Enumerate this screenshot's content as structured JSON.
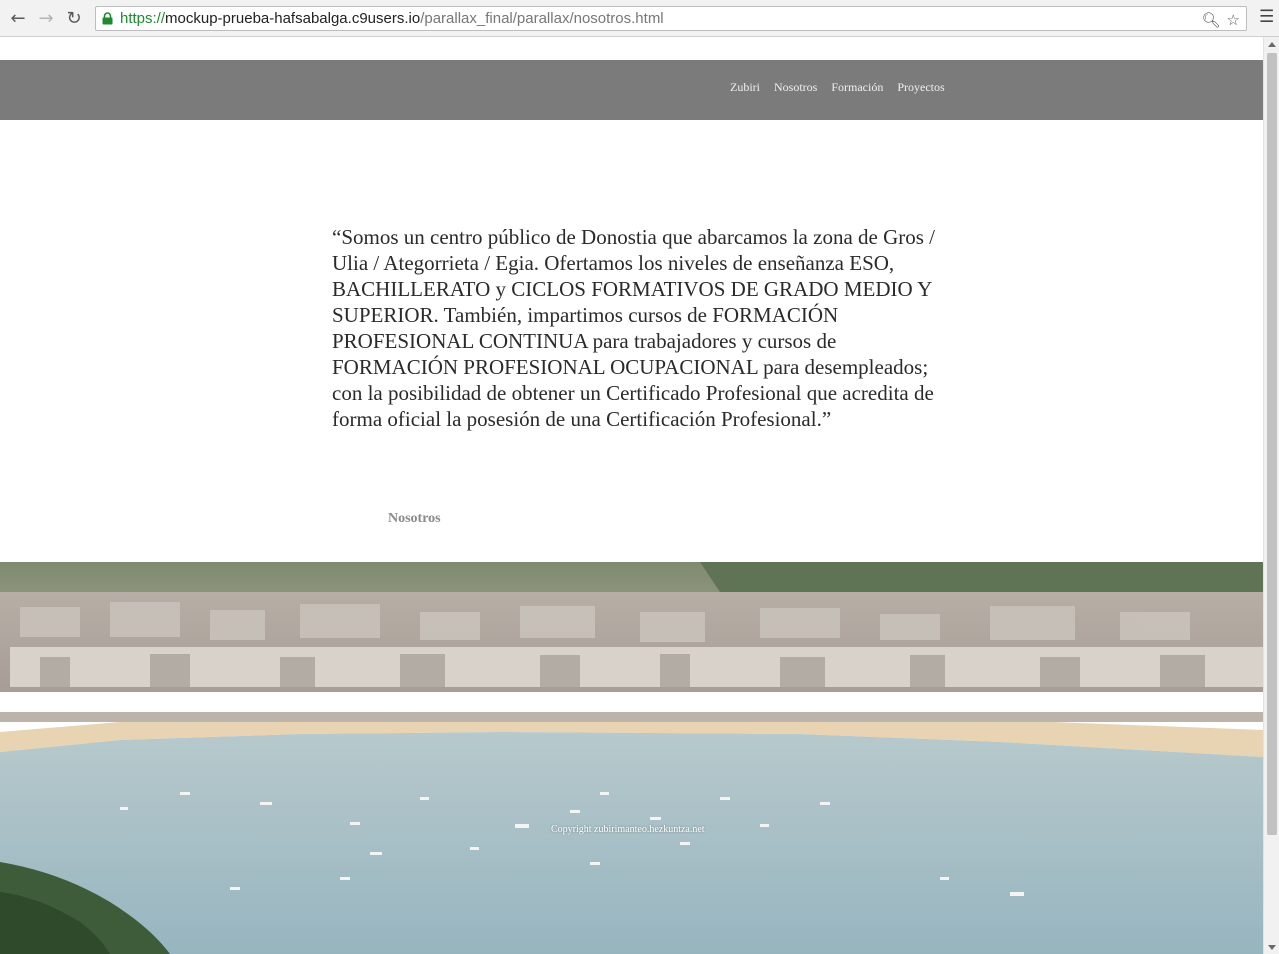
{
  "browser": {
    "url_scheme": "https://",
    "url_host": "mockup-prueba-hafsabalga.c9users.io",
    "url_path": "/parallax_final/parallax/nosotros.html"
  },
  "nav": {
    "items": [
      {
        "label": "Zubiri"
      },
      {
        "label": "Nosotros"
      },
      {
        "label": "Formación"
      },
      {
        "label": "Proyectos"
      }
    ]
  },
  "content": {
    "quote": "“Somos un centro público de Donostia que abarcamos la zona de Gros / Ulia / Ategorrieta / Egia. Ofertamos los niveles de enseñanza ESO, BACHILLERATO y CICLOS FORMATIVOS DE GRADO MEDIO Y SUPERIOR. También, impartimos cursos de FORMACIÓN PROFESIONAL CONTINUA para trabajadores y cursos de FORMACIÓN PROFESIONAL OCUPACIONAL para desempleados; con la posibilidad de obtener un Certificado Profesional que acredita de forma oficial la posesión de una Certificación Profesional.”",
    "section_label": "Nosotros"
  },
  "footer": {
    "copyright": "Copyright zubirimanteo.hezkuntza.net"
  },
  "colors": {
    "navbar": "#7b7b7b",
    "sea": "#a9c3cc",
    "beach": "#e8d3b2"
  }
}
